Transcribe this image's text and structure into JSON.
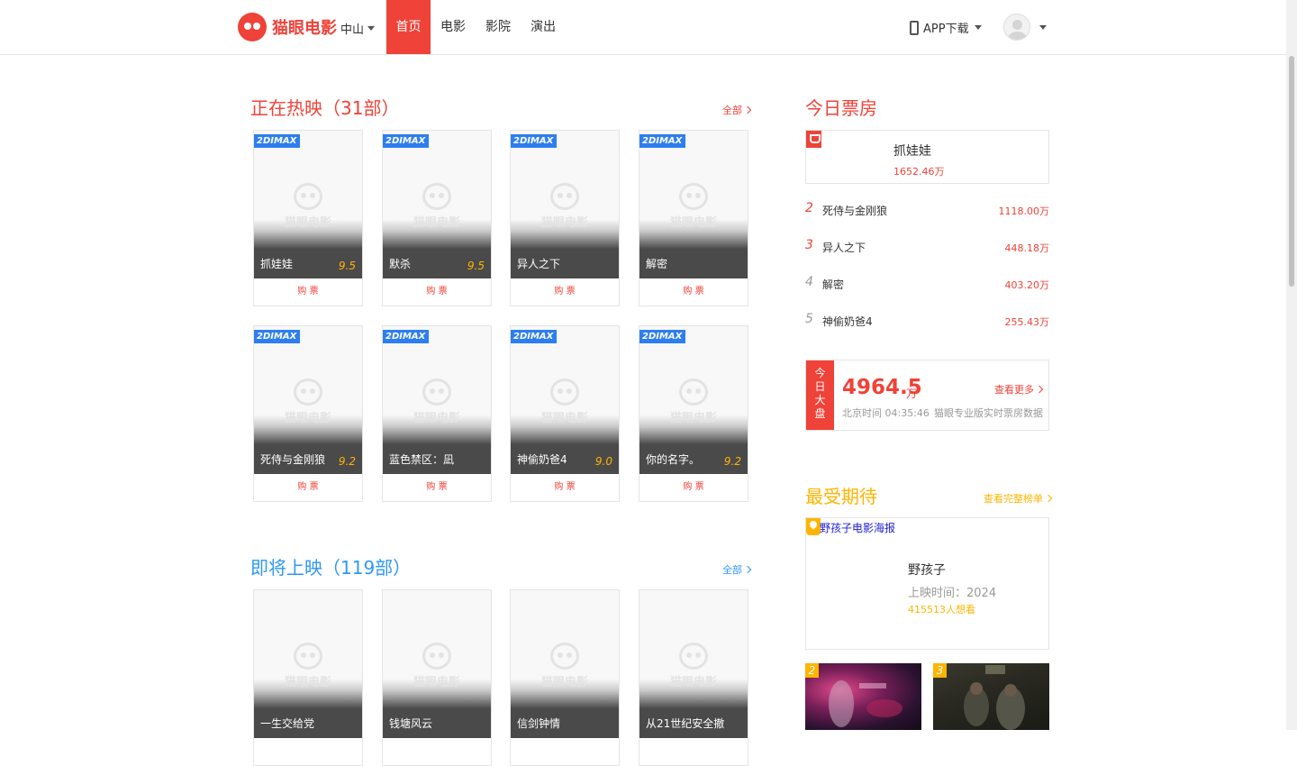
{
  "header": {
    "brand": "猫眼电影",
    "city": "中山",
    "nav": [
      "首页",
      "电影",
      "影院",
      "演出"
    ],
    "app_download": "APP下载"
  },
  "now_showing": {
    "title": "正在热映（31部）",
    "more": "全部",
    "badge": "2DIMAX",
    "buy_label": "购 票",
    "placeholder_brand": "猫眼电影",
    "movies": [
      {
        "name": "抓娃娃",
        "score": "9.5"
      },
      {
        "name": "默杀",
        "score": "9.5"
      },
      {
        "name": "异人之下",
        "score": ""
      },
      {
        "name": "解密",
        "score": ""
      },
      {
        "name": "死侍与金刚狼",
        "score": "9.2"
      },
      {
        "name": "蓝色禁区：凪",
        "score": ""
      },
      {
        "name": "神偷奶爸4",
        "score": "9.0"
      },
      {
        "name": "你的名字。",
        "score": "9.2"
      }
    ]
  },
  "upcoming": {
    "title": "即将上映（119部）",
    "more": "全部",
    "movies": [
      {
        "name": "一生交给党"
      },
      {
        "name": "钱塘风云"
      },
      {
        "name": "信剑钟情"
      },
      {
        "name": "从21世纪安全撤离"
      }
    ]
  },
  "box_office": {
    "title": "今日票房",
    "top": {
      "name": "抓娃娃",
      "box": "1652.46万"
    },
    "ranks": [
      {
        "rank": "2",
        "name": "死侍与金刚狼",
        "box": "1118.00万"
      },
      {
        "rank": "3",
        "name": "异人之下",
        "box": "448.18万"
      },
      {
        "rank": "4",
        "name": "解密",
        "box": "403.20万"
      },
      {
        "rank": "5",
        "name": "神偷奶爸4",
        "box": "255.43万"
      }
    ],
    "total": {
      "tag": "今日大盘",
      "value": "4964.5",
      "unit": "万",
      "more": "查看更多",
      "time": "北京时间 04:35:46",
      "note": "猫眼专业版实时票房数据"
    }
  },
  "anticipated": {
    "title": "最受期待",
    "more": "查看完整榜单",
    "top": {
      "alt": "野孩子电影海报",
      "name": "野孩子",
      "date": "上映时间：2024",
      "want": "415513人想看"
    },
    "minis": [
      {
        "rank": "2"
      },
      {
        "rank": "3"
      }
    ]
  },
  "colors": {
    "brand_red": "#ef4238",
    "imax_blue": "#2d7ef0",
    "score_gold": "#ffb400",
    "upcoming_blue": "#2d98f3"
  }
}
